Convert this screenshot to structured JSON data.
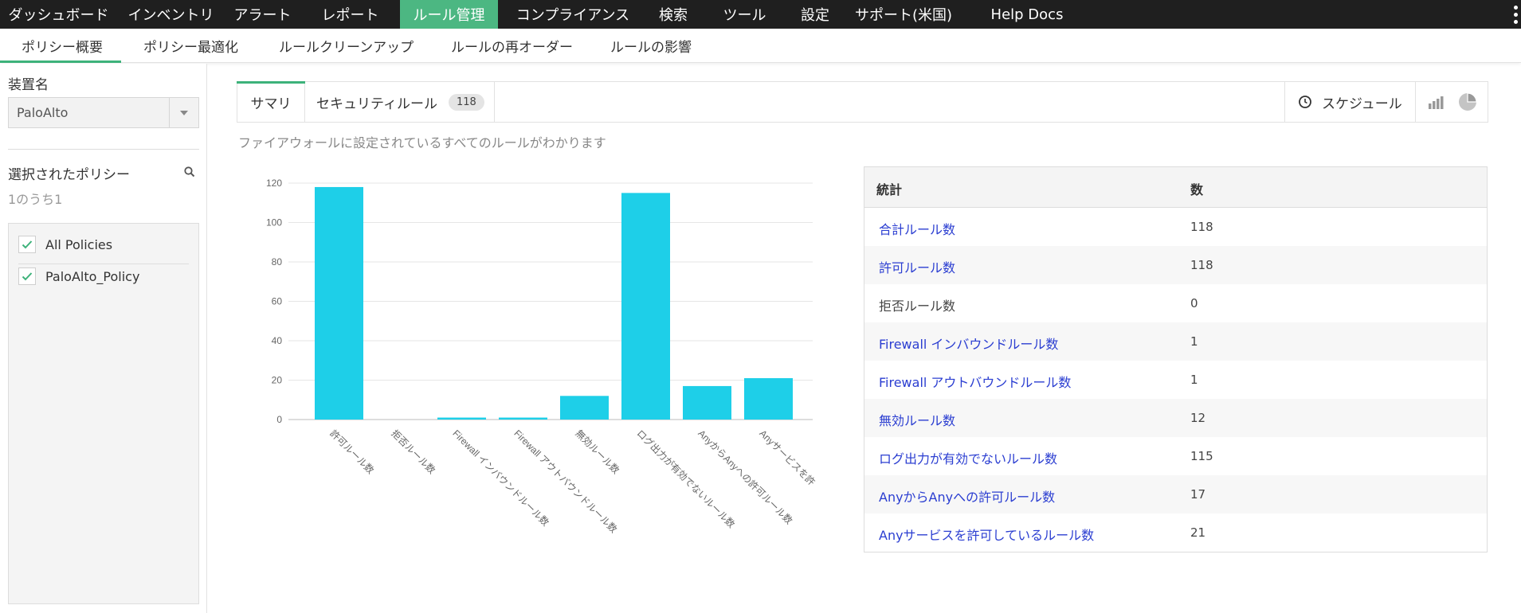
{
  "topnav": {
    "items": [
      {
        "label": "ダッシュボード",
        "active": false
      },
      {
        "label": "インベントリ",
        "active": false
      },
      {
        "label": "アラート",
        "active": false
      },
      {
        "label": "レポート",
        "active": false
      },
      {
        "label": "ルール管理",
        "active": true
      },
      {
        "label": "コンプライアンス",
        "active": false
      },
      {
        "label": "検索",
        "active": false
      },
      {
        "label": "ツール",
        "active": false
      },
      {
        "label": "設定",
        "active": false
      },
      {
        "label": "サポート(米国)",
        "active": false
      },
      {
        "label": "Help Docs",
        "active": false
      }
    ],
    "active_color": "#4cb782",
    "more_icon": "kebab-menu-icon"
  },
  "subnav": {
    "items": [
      "ポリシー概要",
      "ポリシー最適化",
      "ルールクリーンアップ",
      "ルールの再オーダー",
      "ルールの影響"
    ],
    "active_index": 0
  },
  "sidebar": {
    "device_label": "装置名",
    "device_value": "PaloAlto",
    "policy_label": "選択されたポリシー",
    "policy_count": "1のうち1",
    "policies": [
      {
        "label": "All Policies",
        "checked": true
      },
      {
        "label": "PaloAlto_Policy",
        "checked": true
      }
    ]
  },
  "tabs": {
    "summary": "サマリ",
    "security_rules": "セキュリティルール",
    "security_rules_count": "118",
    "schedule": "スケジュール",
    "view_icons": [
      "bar-chart-icon",
      "pie-chart-icon"
    ]
  },
  "description": "ファイアウォールに設定されているすべてのルールがわかります",
  "chart_data": {
    "type": "bar",
    "categories": [
      "許可ルール数",
      "拒否ルール数",
      "Firewall インバウンドルール数",
      "Firewall アウトバウンドルール数",
      "無効ルール数",
      "ログ出力が有効でないルール数",
      "AnyからAnyへの許可ルール数",
      "Anyサービスを許"
    ],
    "values": [
      118,
      0,
      1,
      1,
      12,
      115,
      17,
      21
    ],
    "yticks": [
      "0",
      "20",
      "40",
      "60",
      "80",
      "100",
      "120"
    ],
    "ylim": [
      0,
      120
    ],
    "bar_color": "#1ecfe8",
    "grid": true
  },
  "stats_table": {
    "headers": [
      "統計",
      "数"
    ],
    "rows": [
      {
        "name": "合計ルール数",
        "value": "118",
        "link": true
      },
      {
        "name": "許可ルール数",
        "value": "118",
        "link": true
      },
      {
        "name": "拒否ルール数",
        "value": "0",
        "link": false
      },
      {
        "name": "Firewall インバウンドルール数",
        "value": "1",
        "link": true
      },
      {
        "name": "Firewall アウトバウンドルール数",
        "value": "1",
        "link": true
      },
      {
        "name": "無効ルール数",
        "value": "12",
        "link": true
      },
      {
        "name": "ログ出力が有効でないルール数",
        "value": "115",
        "link": true
      },
      {
        "name": "AnyからAnyへの許可ルール数",
        "value": "17",
        "link": true
      },
      {
        "name": "Anyサービスを許可しているルール数",
        "value": "21",
        "link": true
      }
    ],
    "link_color": "#2b3ed1"
  }
}
